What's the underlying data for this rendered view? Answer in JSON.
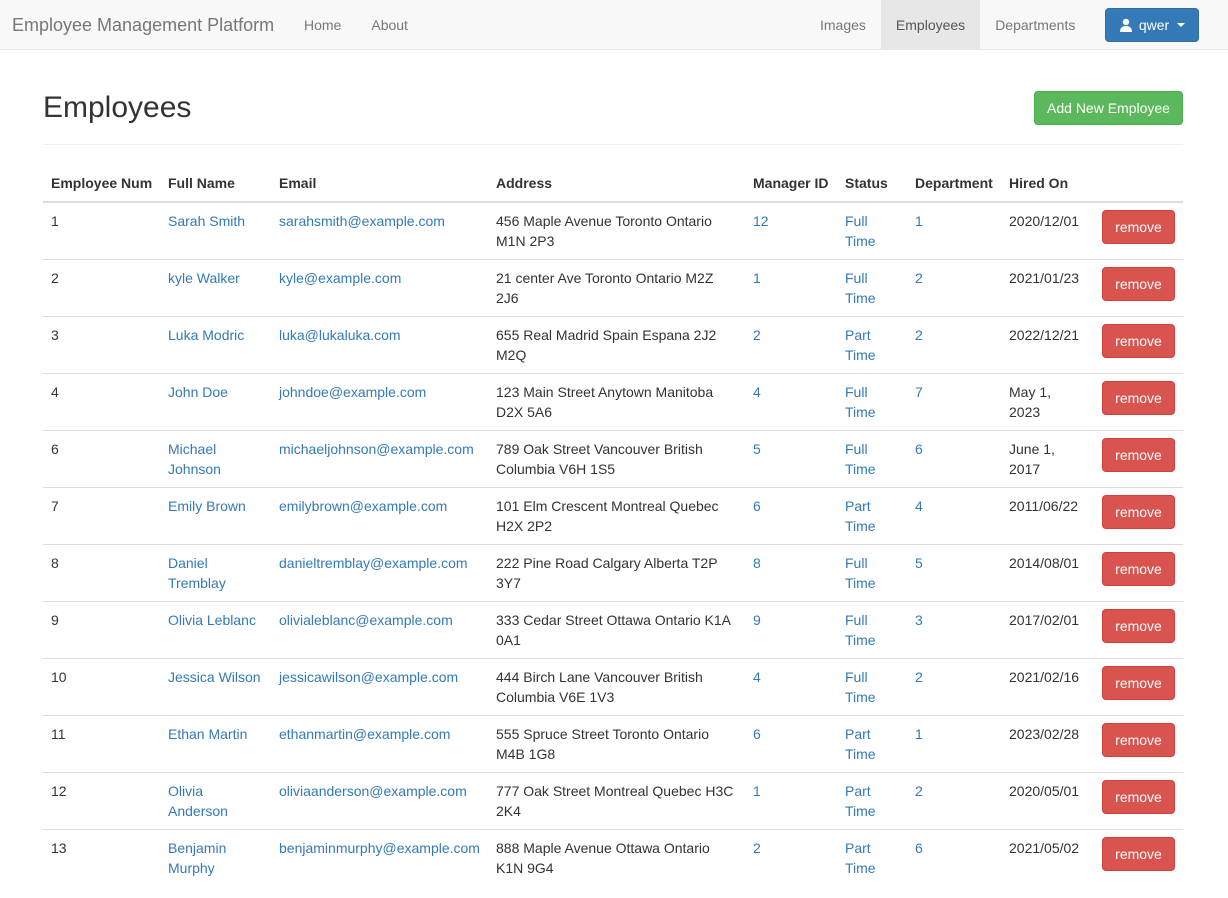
{
  "navbar": {
    "brand": "Employee Management Platform",
    "left_links": [
      {
        "label": "Home"
      },
      {
        "label": "About"
      }
    ],
    "right_links": [
      {
        "label": "Images",
        "active": false
      },
      {
        "label": "Employees",
        "active": true
      },
      {
        "label": "Departments",
        "active": false
      }
    ],
    "user": {
      "label": "qwer",
      "icon": "user-icon"
    }
  },
  "page": {
    "title": "Employees",
    "add_button": "Add New Employee"
  },
  "table": {
    "headers": [
      "Employee Num",
      "Full Name",
      "Email",
      "Address",
      "Manager ID",
      "Status",
      "Department",
      "Hired On",
      ""
    ],
    "remove_label": "remove",
    "rows": [
      {
        "num": "1",
        "name": "Sarah Smith",
        "email": "sarahsmith@example.com",
        "address": "456 Maple Avenue Toronto Ontario M1N 2P3",
        "manager": "12",
        "status": "Full Time",
        "department": "1",
        "hired": "2020/12/01"
      },
      {
        "num": "2",
        "name": "kyle Walker",
        "email": "kyle@example.com",
        "address": "21 center Ave Toronto Ontario M2Z 2J6",
        "manager": "1",
        "status": "Full Time",
        "department": "2",
        "hired": "2021/01/23"
      },
      {
        "num": "3",
        "name": "Luka Modric",
        "email": "luka@lukaluka.com",
        "address": "655 Real Madrid Spain Espana 2J2 M2Q",
        "manager": "2",
        "status": "Part Time",
        "department": "2",
        "hired": "2022/12/21"
      },
      {
        "num": "4",
        "name": "John Doe",
        "email": "johndoe@example.com",
        "address": "123 Main Street Anytown Manitoba D2X 5A6",
        "manager": "4",
        "status": "Full Time",
        "department": "7",
        "hired": "May 1, 2023"
      },
      {
        "num": "6",
        "name": "Michael Johnson",
        "email": "michaeljohnson@example.com",
        "address": "789 Oak Street Vancouver British Columbia V6H 1S5",
        "manager": "5",
        "status": "Full Time",
        "department": "6",
        "hired": "June 1, 2017"
      },
      {
        "num": "7",
        "name": "Emily Brown",
        "email": "emilybrown@example.com",
        "address": "101 Elm Crescent Montreal Quebec H2X 2P2",
        "manager": "6",
        "status": "Part Time",
        "department": "4",
        "hired": "2011/06/22"
      },
      {
        "num": "8",
        "name": "Daniel Tremblay",
        "email": "danieltremblay@example.com",
        "address": "222 Pine Road Calgary Alberta T2P 3Y7",
        "manager": "8",
        "status": "Full Time",
        "department": "5",
        "hired": "2014/08/01"
      },
      {
        "num": "9",
        "name": "Olivia Leblanc",
        "email": "olivialeblanc@example.com",
        "address": "333 Cedar Street Ottawa Ontario K1A 0A1",
        "manager": "9",
        "status": "Full Time",
        "department": "3",
        "hired": "2017/02/01"
      },
      {
        "num": "10",
        "name": "Jessica Wilson",
        "email": "jessicawilson@example.com",
        "address": "444 Birch Lane Vancouver British Columbia V6E 1V3",
        "manager": "4",
        "status": "Full Time",
        "department": "2",
        "hired": "2021/02/16"
      },
      {
        "num": "11",
        "name": "Ethan Martin",
        "email": "ethanmartin@example.com",
        "address": "555 Spruce Street Toronto Ontario M4B 1G8",
        "manager": "6",
        "status": "Part Time",
        "department": "1",
        "hired": "2023/02/28"
      },
      {
        "num": "12",
        "name": "Olivia Anderson",
        "email": "oliviaanderson@example.com",
        "address": "777 Oak Street Montreal Quebec H3C 2K4",
        "manager": "1",
        "status": "Part Time",
        "department": "2",
        "hired": "2020/05/01"
      },
      {
        "num": "13",
        "name": "Benjamin Murphy",
        "email": "benjaminmurphy@example.com",
        "address": "888 Maple Avenue Ottawa Ontario K1N 9G4",
        "manager": "2",
        "status": "Part Time",
        "department": "6",
        "hired": "2021/05/02"
      }
    ]
  },
  "colors": {
    "link": "#337ab7",
    "primary": "#337ab7",
    "success": "#5cb85c",
    "danger": "#d9534f",
    "navbar_bg": "#f8f8f8"
  }
}
